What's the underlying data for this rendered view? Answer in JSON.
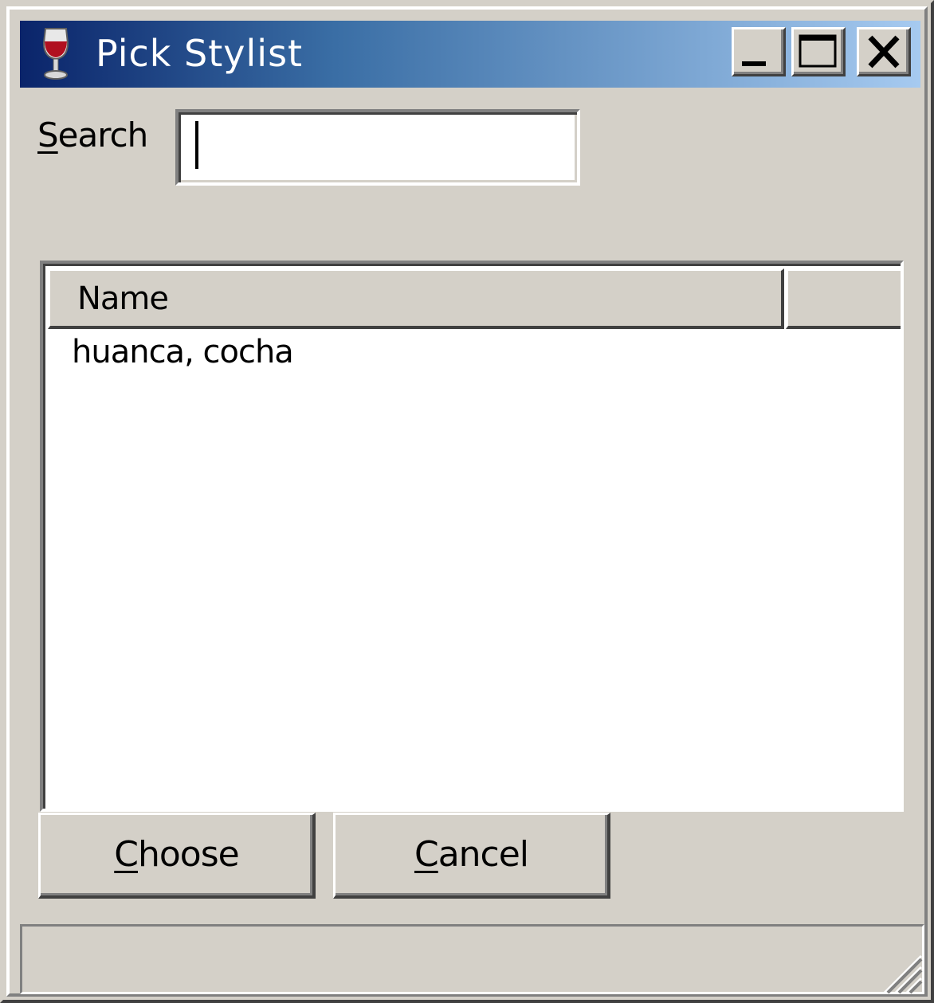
{
  "window": {
    "title": "Pick Stylist",
    "icon": "wine-glass-icon",
    "controls": {
      "minimize": "minimize-icon",
      "maximize": "maximize-icon",
      "close": "close-icon"
    }
  },
  "search": {
    "label_accel": "S",
    "label_rest": "earch",
    "value": ""
  },
  "list": {
    "columns": [
      "Name",
      ""
    ],
    "rows": [
      "huanca, cocha"
    ]
  },
  "buttons": {
    "choose_accel": "C",
    "choose_rest": "hoose",
    "cancel_accel": "C",
    "cancel_rest": "ancel"
  },
  "colors": {
    "face": "#d4d0c8",
    "title_start": "#0a246a",
    "title_end": "#a6caf0"
  }
}
